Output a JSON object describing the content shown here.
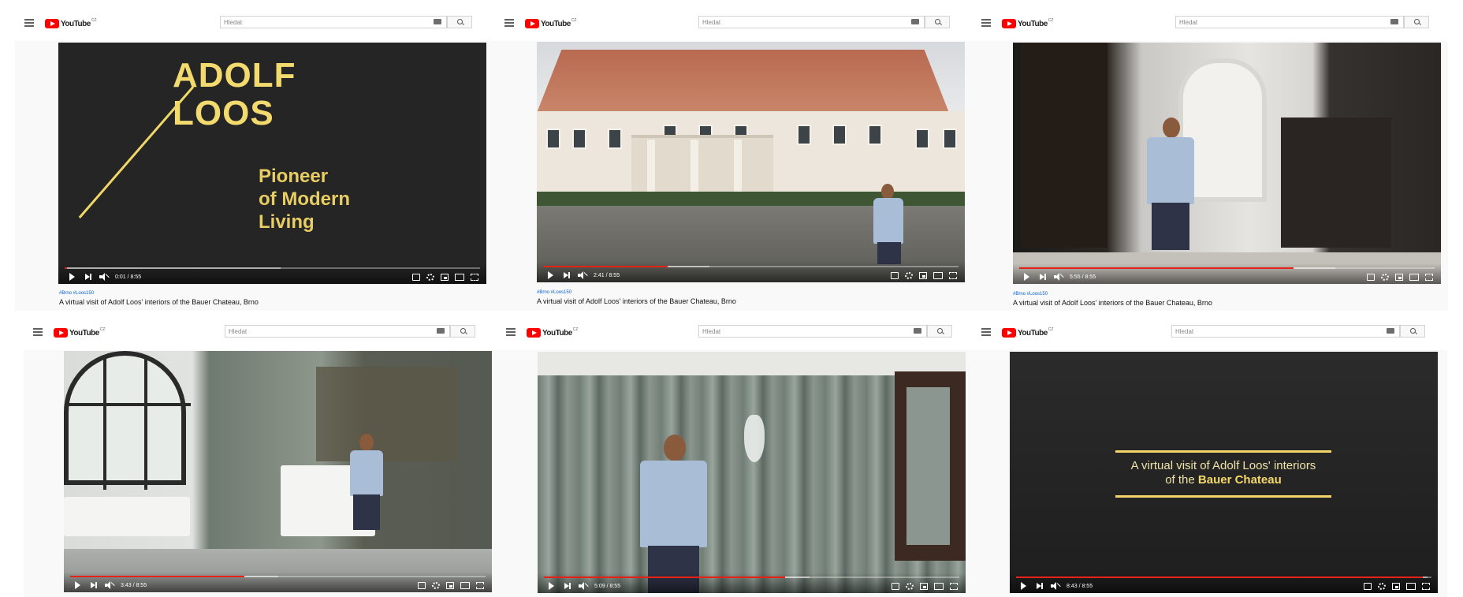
{
  "youtube": {
    "logo_text": "YouTube",
    "region": "CZ",
    "search_placeholder": "Hledat"
  },
  "video": {
    "title": "A virtual visit of Adolf Loos' interiors of the Bauer Chateau, Brno",
    "hashtags": "#Brno #Loos150",
    "duration": "8:55"
  },
  "frames": [
    {
      "time": "0:01 / 8:55",
      "progress": 0.002,
      "overlay": {
        "title": "ADOLF LOOS",
        "subtitle": "Pioneer of Modern Living"
      }
    },
    {
      "time": "2:41 / 8:55",
      "progress": 0.3
    },
    {
      "time": "5:55 / 8:55",
      "progress": 0.66
    },
    {
      "time": "3:43 / 8:55",
      "progress": 0.42
    },
    {
      "time": "5:09 / 8:55",
      "progress": 0.58
    },
    {
      "time": "8:43 / 8:55",
      "progress": 0.98,
      "overlay": {
        "line1": "A virtual visit of Adolf Loos' interiors",
        "line2_prefix": "of the",
        "line2_bold": "Bauer Chateau"
      }
    }
  ],
  "colors": {
    "youtube_red": "#ff0000",
    "progress_red": "#e62117",
    "title_gold": "#f2da6e"
  }
}
